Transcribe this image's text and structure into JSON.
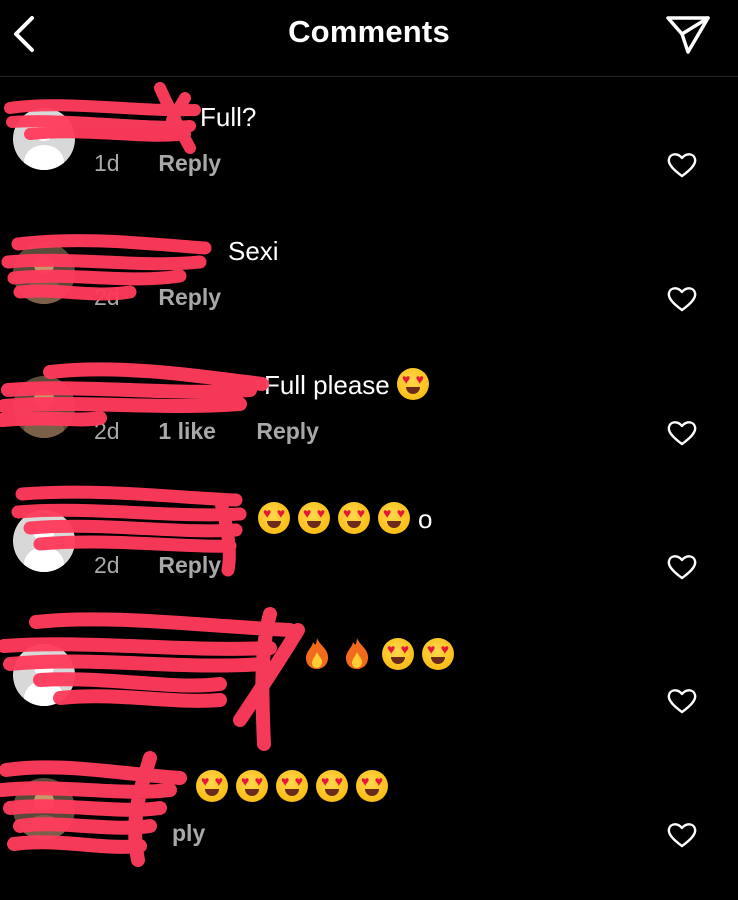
{
  "header": {
    "title": "Comments",
    "back_icon": "chevron-left-icon",
    "send_icon": "paper-plane-icon"
  },
  "colors": {
    "background": "#000000",
    "meta_text": "#a8a8a8",
    "redaction": "#ff3b5c"
  },
  "comments": [
    {
      "text": "Full?",
      "time": "1d",
      "likes": "",
      "reply": "Reply",
      "avatar": "default-avatar"
    },
    {
      "text": "Sexi",
      "time": "2d",
      "likes": "",
      "reply": "Reply",
      "avatar": "photo-avatar"
    },
    {
      "text": "Full please",
      "time": "2d",
      "likes": "1 like",
      "reply": "Reply",
      "avatar": "photo-avatar"
    },
    {
      "text": "o",
      "time": "2d",
      "likes": "",
      "reply": "Reply",
      "avatar": "default-avatar"
    },
    {
      "text": "",
      "time": "",
      "likes": "",
      "reply": "",
      "avatar": "default-avatar"
    },
    {
      "text": "",
      "time": "",
      "likes": "",
      "reply": "ply",
      "avatar": "photo-avatar"
    }
  ]
}
